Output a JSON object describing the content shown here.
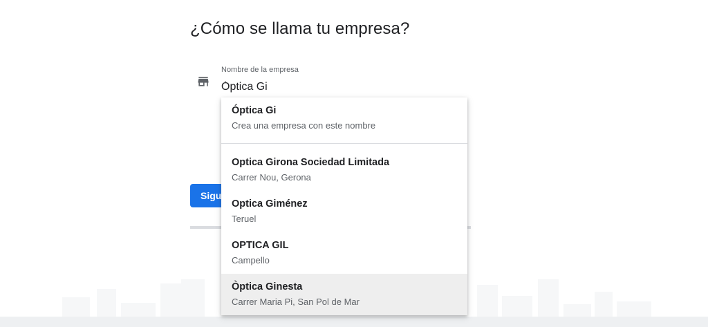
{
  "page": {
    "title": "¿Cómo se llama tu empresa?"
  },
  "field": {
    "label": "Nombre de la empresa",
    "value": "Óptica Gi",
    "icon": "store-icon"
  },
  "next_button": {
    "label": "Siguiente"
  },
  "dropdown": {
    "options": [
      {
        "name": "Óptica Gi",
        "sub": "Crea una empresa con este nombre"
      },
      {
        "name": "Optica Girona Sociedad Limitada",
        "sub": "Carrer Nou, Gerona"
      },
      {
        "name": "Optica Giménez",
        "sub": "Teruel"
      },
      {
        "name": "OPTICA GIL",
        "sub": "Campello"
      },
      {
        "name": "Òptica Ginesta",
        "sub": "Carrer Maria Pi, San Pol de Mar"
      }
    ],
    "hovered_index": 4
  },
  "colors": {
    "accent": "#1a73e8",
    "text": "#202124",
    "secondary_text": "#5f6368",
    "divider": "#dadce0",
    "hover": "#eeeeee"
  }
}
